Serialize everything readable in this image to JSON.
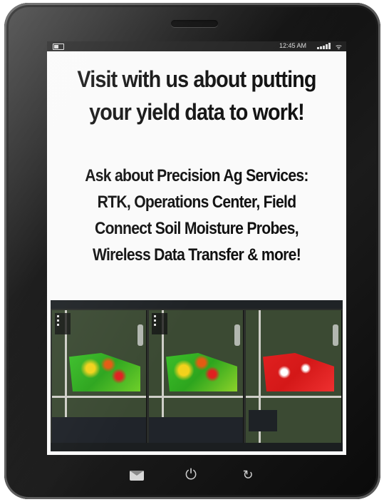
{
  "status_bar": {
    "time": "12:45 AM",
    "wifi_icon": "wifi-icon",
    "battery_icon": "battery-icon",
    "signal_icon": "signal-bars-icon"
  },
  "headline": {
    "line1": "Visit with us about putting",
    "line2": "your yield data to work!"
  },
  "subline": {
    "line1": "Ask about Precision Ag Services:",
    "line2": "RTK, Operations Center, Field",
    "line3": "Connect Soil Moisture Probes,",
    "line4": "Wireless Data Transfer & more!"
  },
  "photo": {
    "panels": [
      "yield-map-panel-1",
      "yield-map-panel-2",
      "yield-map-panel-3"
    ]
  },
  "dock": {
    "mail_icon": "mail-icon",
    "power_icon": "power-icon",
    "refresh_icon": "refresh-icon",
    "power_glyph": "⏻",
    "refresh_glyph": "↻"
  },
  "colors": {
    "bezel": "#111111",
    "screen": "#fafafa",
    "text": "#111111",
    "yield_green": "#3cbf2a",
    "yield_red": "#e02020",
    "yield_yellow": "#f2d21c"
  }
}
